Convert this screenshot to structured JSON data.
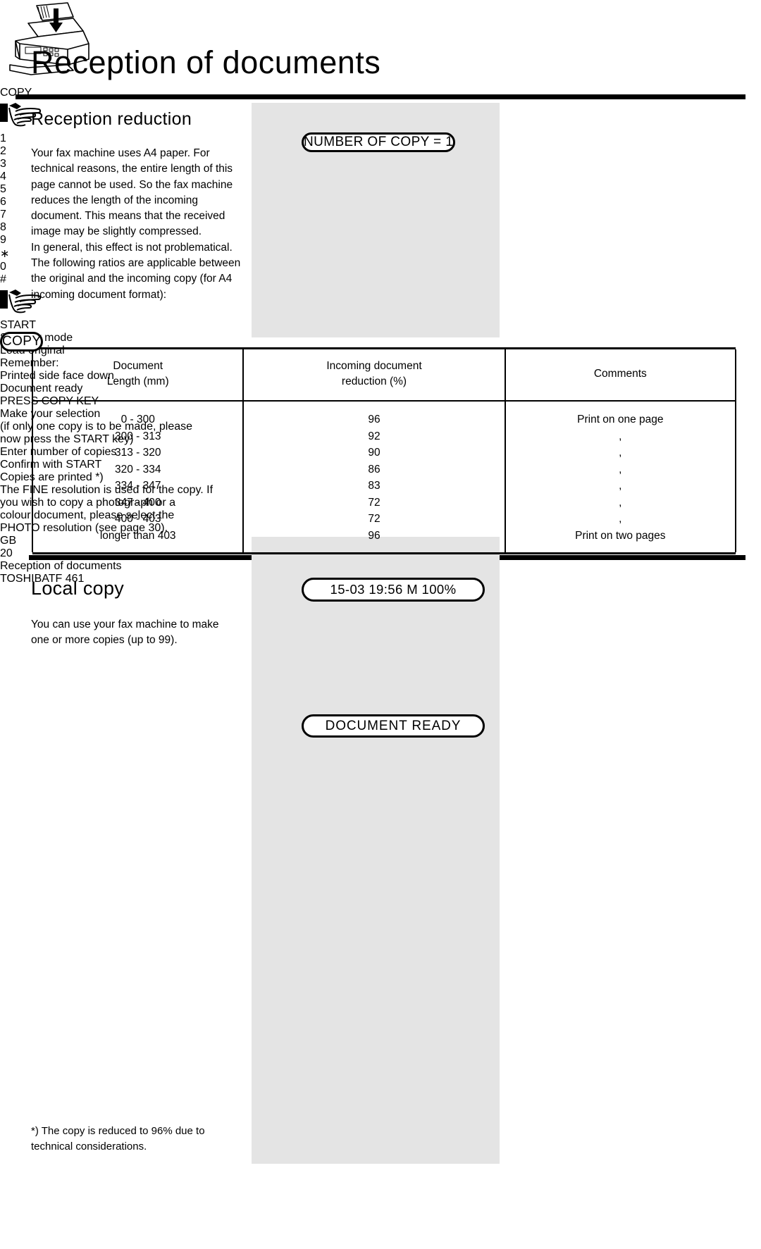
{
  "header": {
    "title": "Reception of documents"
  },
  "sections": {
    "reduction": {
      "heading": "Reception reduction",
      "paragraph": "Your fax machine uses A4 paper. For technical reasons, the entire length of this page cannot be used. So the fax machine reduces the length of the incoming document. This means that the received image may be slightly compressed.\nIn general, this effect is not problematical.\nThe following ratios are applicable between the original and the incoming copy (for A4 incoming document format):"
    },
    "local_copy": {
      "heading": "Local copy",
      "paragraph": "You can use your fax machine to make one or more copies (up to 99).",
      "footnote": "*) The copy is reduced to 96% due to technical considerations."
    }
  },
  "table": {
    "headers": [
      "Document\nLength (mm)",
      "Incoming document\nreduction (%)",
      "Comments"
    ],
    "header_lines": {
      "col1_line1": "Document",
      "col1_line2": "Length (mm)",
      "col2_line1": "Incoming document",
      "col2_line2": "reduction (%)",
      "col3_line1": "Comments"
    },
    "rows": [
      {
        "length": "0 - 300",
        "reduction": "96",
        "comment": "Print on one page"
      },
      {
        "length": "300 - 313",
        "reduction": "92",
        "comment": ","
      },
      {
        "length": "313 - 320",
        "reduction": "90",
        "comment": ","
      },
      {
        "length": "320 - 334",
        "reduction": "86",
        "comment": ","
      },
      {
        "length": "334 - 347",
        "reduction": "83",
        "comment": ","
      },
      {
        "length": "347 - 400",
        "reduction": "72",
        "comment": ","
      },
      {
        "length": "400 - 403",
        "reduction": "72",
        "comment": ","
      },
      {
        "length": "longer than 403",
        "reduction": "96",
        "comment": "Print on two pages"
      }
    ],
    "lengths_block": "0 - 300\n300 - 313\n313 - 320\n320 - 334\n334 - 347\n347 - 400\n400 - 403\nlonger than 403",
    "reductions_block": "96\n92\n90\n86\n83\n72\n72\n96",
    "comments_block": "Print on one page\n,\n,\n,\n,\n,\n,\nPrint on two pages"
  },
  "procedure": {
    "displays": {
      "standby": "15-03 19:56  M 100%",
      "document_ready": "DOCUMENT READY",
      "number_of_copy": "NUMBER OF COPY   = 1",
      "copy": "COPY"
    },
    "keys": {
      "copy_label": "COPY",
      "start_label": "START",
      "copy_icon": "document-copy-icon",
      "start_icon": "start-arrow-icon",
      "hand_icon": "pointing-hand-icon",
      "fax_icon": "fax-machine-load-original-icon"
    },
    "keypad": [
      [
        "1",
        "2",
        "3"
      ],
      [
        "4",
        "5",
        "6"
      ],
      [
        "7",
        "8",
        "9"
      ],
      [
        "∗",
        "0",
        "#"
      ]
    ],
    "annotations": {
      "standby": "Standby mode",
      "load_original_heading": "Load original",
      "load_original_line1": "Remember:",
      "load_original_line2": "Printed side face down",
      "document_ready": "Document ready",
      "press_copy_key": "PRESS COPY KEY",
      "make_selection_line1": "Make your selection",
      "make_selection_line2": "(if only one copy is to be made, please",
      "make_selection_line3": "now press the START key)",
      "enter_copies": "Enter number of copies",
      "confirm_start": "Confirm with START",
      "printed_line1": "Copies are printed *)",
      "printed_line2": "The FINE resolution is used for the copy. If",
      "printed_line3": "you wish to copy a photograph or a",
      "printed_line4": "colour document, please select the",
      "printed_line5_pre": "PHOTO resolution (see ",
      "printed_link": "page 30",
      "printed_line5_post": ")."
    }
  },
  "footer": {
    "locale_badge": "GB",
    "page_number": "20",
    "title": "Reception of documents",
    "brand": "TOSHIBA",
    "model": "TF 461"
  },
  "colors": {
    "band": "#e4e4e4",
    "link": "#e2001a",
    "rule": "#000000"
  }
}
